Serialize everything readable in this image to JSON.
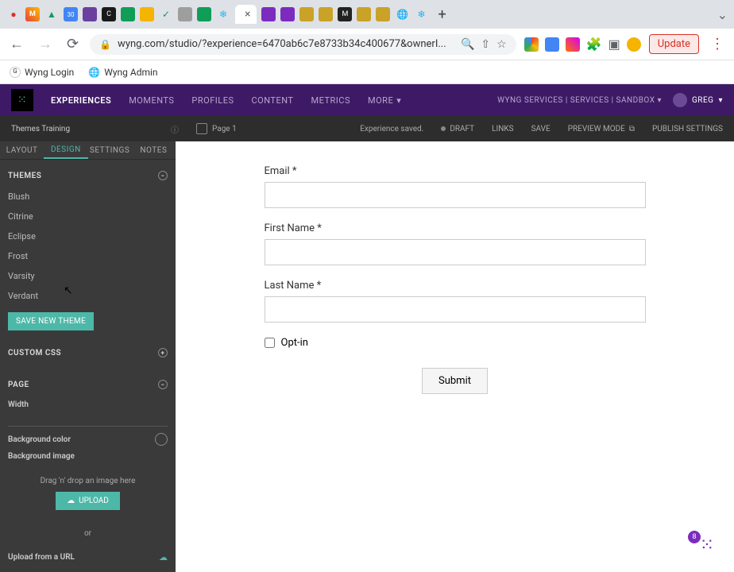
{
  "browser": {
    "url": "wyng.com/studio/?experience=6470ab6c7e8733b34c400677&ownerI...",
    "update_btn": "Update"
  },
  "bookmarks": {
    "item1": "Wyng Login",
    "item2": "Wyng Admin"
  },
  "app_nav": {
    "experiences": "EXPERIENCES",
    "moments": "MOMENTS",
    "profiles": "PROFILES",
    "content": "CONTENT",
    "metrics": "METRICS",
    "more": "MORE",
    "account": "WYNG SERVICES | SERVICES | SANDBOX",
    "user": "GREG"
  },
  "secondary": {
    "experience_name": "Themes Training",
    "page_label": "Page 1",
    "saved_text": "Experience saved.",
    "draft": "DRAFT",
    "links": "LINKS",
    "save": "SAVE",
    "preview": "PREVIEW MODE",
    "publish": "PUBLISH SETTINGS"
  },
  "sidebar": {
    "tabs": {
      "layout": "LAYOUT",
      "design": "DESIGN",
      "settings": "SETTINGS",
      "notes": "NOTES"
    },
    "themes_header": "THEMES",
    "themes": [
      "Blush",
      "Citrine",
      "Eclipse",
      "Frost",
      "Varsity",
      "Verdant"
    ],
    "save_theme_btn": "SAVE NEW THEME",
    "custom_css_header": "CUSTOM CSS",
    "page_header": "PAGE",
    "width_label": "Width",
    "bg_color_label": "Background color",
    "bg_image_label": "Background image",
    "dropzone_text": "Drag 'n' drop an image here",
    "upload_btn": "UPLOAD",
    "or_text": "or",
    "url_upload_label": "Upload from a URL"
  },
  "form": {
    "email_label": "Email *",
    "first_name_label": "First Name *",
    "last_name_label": "Last Name *",
    "optin_label": "Opt-in",
    "submit_label": "Submit"
  },
  "float_badge": "8"
}
